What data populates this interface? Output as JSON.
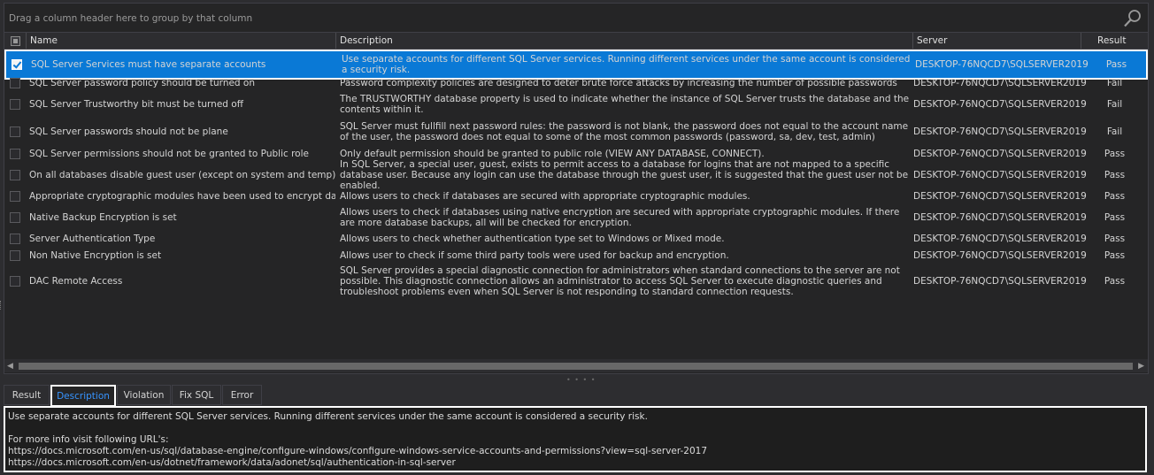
{
  "group_hint": "Drag a column header here to group by that column",
  "columns": {
    "name": "Name",
    "description": "Description",
    "server": "Server",
    "result": "Result"
  },
  "rows": [
    {
      "checked": true,
      "name": "SQL Server Services must have separate accounts",
      "description": "Use separate accounts for different SQL Server services. Running different services under the same account is considered a security risk.",
      "server": "DESKTOP-76NQCD7\\SQLSERVER2019",
      "result": "Pass"
    },
    {
      "checked": false,
      "name": "SQL Server password policy should be turned on",
      "description": "Password complexity policies are designed to deter brute force attacks by increasing the number of possible passwords",
      "server": "DESKTOP-76NQCD7\\SQLSERVER2019",
      "result": "Fail"
    },
    {
      "checked": false,
      "name": "SQL Server Trustworthy bit must be turned off",
      "description": "The TRUSTWORTHY database property is used to indicate whether the instance of SQL Server trusts the database and the contents within it.",
      "server": "DESKTOP-76NQCD7\\SQLSERVER2019",
      "result": "Fail"
    },
    {
      "checked": false,
      "name": "SQL Server passwords should not be plane",
      "description": "SQL Server must fullfill next password rules: the password is not blank, the password does not equal to the account name of the user, the password does not equal to some of the most common passwords (password, sa, dev, test, admin)",
      "server": "DESKTOP-76NQCD7\\SQLSERVER2019",
      "result": "Fail"
    },
    {
      "checked": false,
      "name": "SQL Server permissions should not be granted to Public role",
      "description": "Only default permission should be granted to public role (VIEW ANY DATABASE, CONNECT).",
      "server": "DESKTOP-76NQCD7\\SQLSERVER2019",
      "result": "Pass"
    },
    {
      "checked": false,
      "name": "On all databases disable guest user (except on system and temp)",
      "description": "In SQL Server, a special user, guest, exists to permit access to a database for logins that are not mapped to a specific database user. Because any login can use the database through the guest user, it is suggested that the guest user not be enabled.",
      "server": "DESKTOP-76NQCD7\\SQLSERVER2019",
      "result": "Pass"
    },
    {
      "checked": false,
      "name": "Appropriate cryptographic modules have been used to encrypt data",
      "description": "Allows users to check if databases are secured with appropriate cryptographic modules.",
      "server": "DESKTOP-76NQCD7\\SQLSERVER2019",
      "result": "Pass"
    },
    {
      "checked": false,
      "name": "Native Backup Encryption is set",
      "description": "Allows users to check if databases using native encryption are secured with appropriate cryptographic modules. If there are more database backups, all will be checked for encryption.",
      "server": "DESKTOP-76NQCD7\\SQLSERVER2019",
      "result": "Pass"
    },
    {
      "checked": false,
      "name": "Server Authentication Type",
      "description": "Allows users to check whether authentication type set to Windows or Mixed mode.",
      "server": "DESKTOP-76NQCD7\\SQLSERVER2019",
      "result": "Pass"
    },
    {
      "checked": false,
      "name": "Non Native Encryption is set",
      "description": "Allows user to check if some third party tools were used for backup and encryption.",
      "server": "DESKTOP-76NQCD7\\SQLSERVER2019",
      "result": "Pass"
    },
    {
      "checked": false,
      "name": "DAC Remote Access",
      "description": "SQL Server provides a special diagnostic connection for administrators when standard connections to the server are not possible. This diagnostic connection allows an administrator to access SQL Server to execute diagnostic queries and troubleshoot problems even when SQL Server is not responding to standard connection requests.",
      "server": "DESKTOP-76NQCD7\\SQLSERVER2019",
      "result": "Pass"
    }
  ],
  "tabs": [
    "Result",
    "Description",
    "Violation",
    "Fix SQL",
    "Error"
  ],
  "active_tab": "Description",
  "detail": {
    "line1": "Use separate accounts for different SQL Server services. Running different services under the same account is considered a security risk.",
    "line2": "For more info visit following URL's:",
    "line3": "https://docs.microsoft.com/en-us/sql/database-engine/configure-windows/configure-windows-service-accounts-and-permissions?view=sql-server-2017",
    "line4": "https://docs.microsoft.com/en-us/dotnet/framework/data/adonet/sql/authentication-in-sql-server"
  },
  "icons": {
    "search": "search-icon",
    "left": "scroll-left-icon",
    "right": "scroll-right-icon"
  },
  "colors": {
    "selection": "#0a79d6",
    "active_tab_text": "#3794ff",
    "background": "#252526"
  }
}
